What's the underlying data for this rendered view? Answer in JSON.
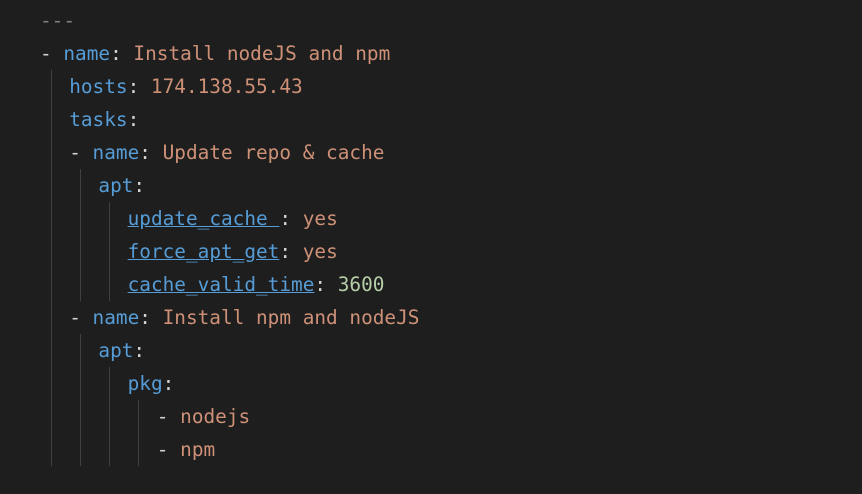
{
  "editor": {
    "language": "yaml",
    "colors": {
      "background": "#1e1e1e",
      "key": "#569cd6",
      "string": "#ce9178",
      "number": "#b5cea8",
      "punctuation": "#d4d4d4",
      "indent_guide": "#404040"
    },
    "lines": [
      {
        "indent": 0,
        "tokens": [
          {
            "t": "---",
            "c": "doc"
          }
        ]
      },
      {
        "indent": 0,
        "tokens": [
          {
            "t": "- ",
            "c": "dash"
          },
          {
            "t": "name",
            "c": "key"
          },
          {
            "t": ": ",
            "c": "punc"
          },
          {
            "t": "Install nodeJS and npm",
            "c": "str"
          }
        ]
      },
      {
        "indent": 2,
        "tokens": [
          {
            "t": "hosts",
            "c": "key"
          },
          {
            "t": ": ",
            "c": "punc"
          },
          {
            "t": "174.138.55.43",
            "c": "str"
          }
        ]
      },
      {
        "indent": 2,
        "tokens": [
          {
            "t": "tasks",
            "c": "key"
          },
          {
            "t": ":",
            "c": "punc"
          }
        ]
      },
      {
        "indent": 2,
        "tokens": [
          {
            "t": "- ",
            "c": "dash"
          },
          {
            "t": "name",
            "c": "key"
          },
          {
            "t": ": ",
            "c": "punc"
          },
          {
            "t": "Update repo & cache",
            "c": "str"
          }
        ]
      },
      {
        "indent": 4,
        "tokens": [
          {
            "t": "apt",
            "c": "key"
          },
          {
            "t": ":",
            "c": "punc"
          }
        ]
      },
      {
        "indent": 6,
        "tokens": [
          {
            "t": "update_cache ",
            "c": "key-u"
          },
          {
            "t": ": ",
            "c": "punc"
          },
          {
            "t": "yes",
            "c": "str"
          }
        ]
      },
      {
        "indent": 6,
        "tokens": [
          {
            "t": "force_apt_get",
            "c": "key-u"
          },
          {
            "t": ": ",
            "c": "punc"
          },
          {
            "t": "yes",
            "c": "str"
          }
        ]
      },
      {
        "indent": 6,
        "tokens": [
          {
            "t": "cache_valid_time",
            "c": "key-u"
          },
          {
            "t": ": ",
            "c": "punc"
          },
          {
            "t": "3600",
            "c": "num"
          }
        ]
      },
      {
        "indent": 2,
        "tokens": [
          {
            "t": "- ",
            "c": "dash"
          },
          {
            "t": "name",
            "c": "key"
          },
          {
            "t": ": ",
            "c": "punc"
          },
          {
            "t": "Install npm and nodeJS",
            "c": "str"
          }
        ]
      },
      {
        "indent": 4,
        "tokens": [
          {
            "t": "apt",
            "c": "key"
          },
          {
            "t": ":",
            "c": "punc"
          }
        ]
      },
      {
        "indent": 6,
        "tokens": [
          {
            "t": "pkg",
            "c": "key"
          },
          {
            "t": ":",
            "c": "punc"
          }
        ]
      },
      {
        "indent": 8,
        "tokens": [
          {
            "t": "- ",
            "c": "dash"
          },
          {
            "t": "nodejs",
            "c": "str"
          }
        ]
      },
      {
        "indent": 8,
        "tokens": [
          {
            "t": "- ",
            "c": "dash"
          },
          {
            "t": "npm",
            "c": "str"
          }
        ]
      }
    ],
    "guides": [
      {
        "col": 1,
        "from": 2,
        "to": 13
      },
      {
        "col": 3,
        "from": 5,
        "to": 8
      },
      {
        "col": 3,
        "from": 10,
        "to": 13
      },
      {
        "col": 5,
        "from": 6,
        "to": 8
      },
      {
        "col": 5,
        "from": 11,
        "to": 13
      },
      {
        "col": 7,
        "from": 12,
        "to": 13
      }
    ]
  }
}
